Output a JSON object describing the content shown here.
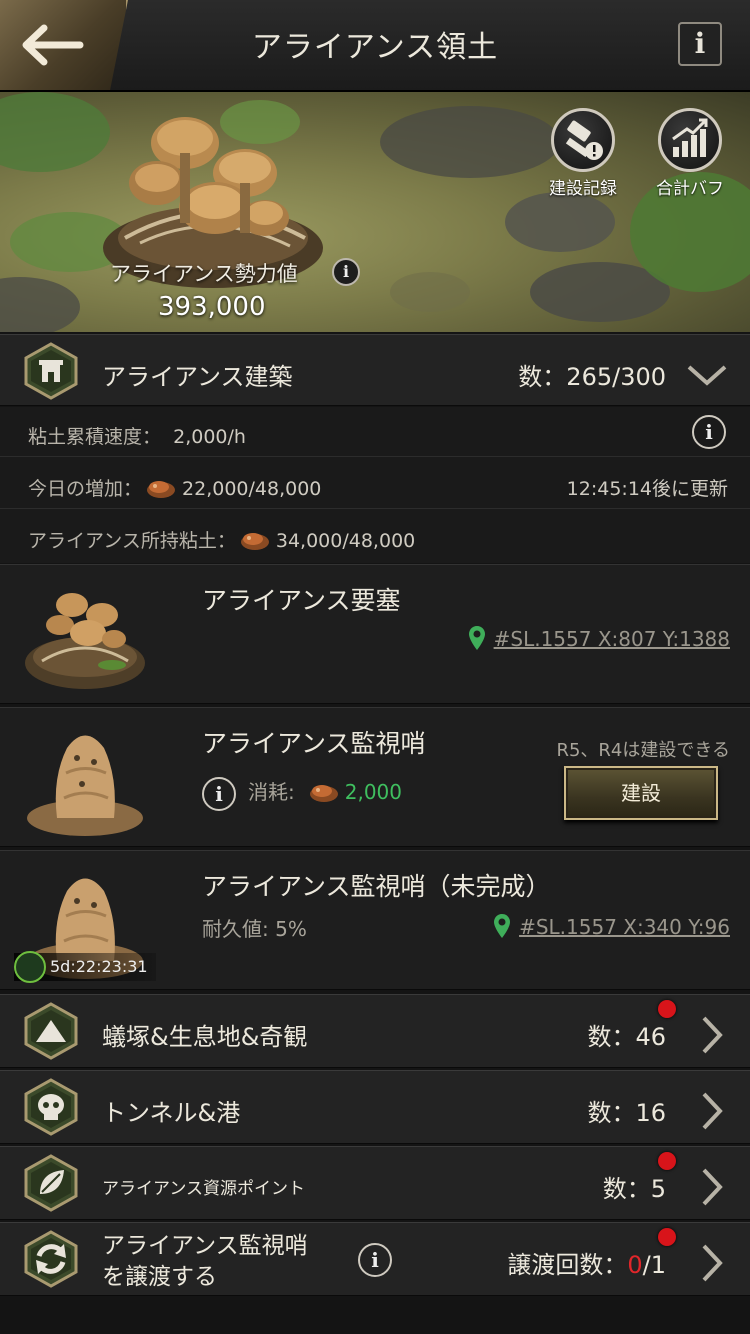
{
  "header": {
    "title": "アライアンス領土",
    "info_label": "i"
  },
  "banner": {
    "power_label": "アライアンス勢力値",
    "power_info": "i",
    "power_value": "393,000",
    "build_log_label": "建設記録",
    "total_buff_label": "合計バフ"
  },
  "building_section": {
    "title": "アライアンス建築",
    "count": "数：265/300",
    "clay_rate_label": "粘土累積速度：",
    "clay_rate_value": "2,000/h",
    "today_label": "今日の増加：",
    "today_value": "22,000/48,000",
    "refresh_text": "12:45:14後に更新",
    "owned_label": "アライアンス所持粘土：",
    "owned_value": "34,000/48,000",
    "info_label": "i"
  },
  "buildings": [
    {
      "name": "アライアンス要塞",
      "coord": "#SL.1557  X:807  Y:1388"
    },
    {
      "name": "アライアンス監視哨",
      "permission": "R5、R4は建設できる",
      "cost_label": "消耗:",
      "cost_value": "2,000",
      "build_label": "建設",
      "info_label": "i"
    },
    {
      "name": "アライアンス監視哨（未完成）",
      "durability": "耐久値: 5%",
      "coord": "#SL.1557  X:340  Y:96",
      "timer": "5d:22:23:31"
    }
  ],
  "menu": [
    {
      "title": "蟻塚&生息地&奇観",
      "count": "数：46",
      "badge": true
    },
    {
      "title": "トンネル&港",
      "count": "数：16",
      "badge": false
    },
    {
      "title": "アライアンス資源ポイント",
      "count": "数：5",
      "badge": true
    },
    {
      "title_line1": "アライアンス監視哨",
      "title_line2": "を譲渡する",
      "count_label": "譲渡回数：",
      "count_used": "0",
      "count_total": "/1",
      "badge": true,
      "info_label": "i"
    }
  ],
  "colors": {
    "accent_gold": "#cbb887",
    "green": "#3fbf5f",
    "badge_red": "#d8141a",
    "pin_green": "#3fae5a"
  }
}
